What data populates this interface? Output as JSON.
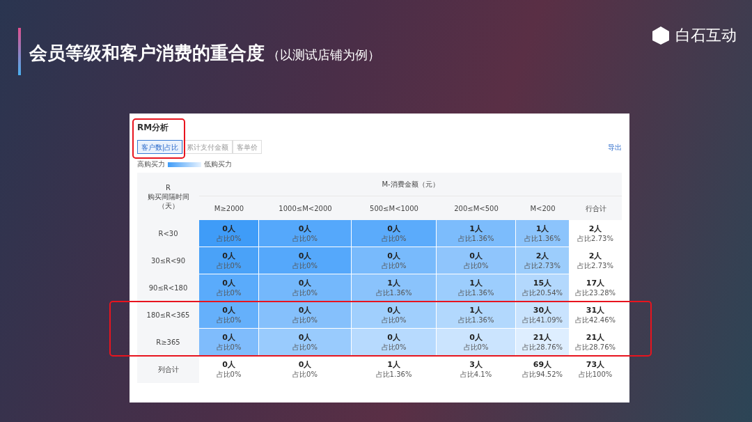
{
  "slide": {
    "title": "会员等级和客户消费的重合度",
    "subtitle": "（以测试店铺为例）",
    "logo_text": "白石互动"
  },
  "panel": {
    "title": "RM分析",
    "tabs": [
      {
        "label": "客户数|占比",
        "selected": true
      },
      {
        "label": "累计支付金额",
        "selected": false
      },
      {
        "label": "客单价",
        "selected": false
      }
    ],
    "export": "导出",
    "legend": {
      "high": "高购买力",
      "low": "低购买力"
    },
    "table": {
      "corner": [
        "R",
        "购买间隔时间",
        "（天）"
      ],
      "group_header": "M-消费金额（元）",
      "columns": [
        "M≥2000",
        "1000≤M<2000",
        "500≤M<1000",
        "200≤M<500",
        "M<200",
        "行合计"
      ],
      "rows": [
        {
          "label": "R<30",
          "cells": [
            {
              "count": "0人",
              "share": "占比0%",
              "color": "#3f9cf8"
            },
            {
              "count": "0人",
              "share": "占比0%",
              "color": "#55a8fb"
            },
            {
              "count": "0人",
              "share": "占比0%",
              "color": "#5babfb"
            },
            {
              "count": "1人",
              "share": "占比1.36%",
              "color": "#7cbcfc"
            },
            {
              "count": "1人",
              "share": "占比1.36%",
              "color": "#8cc4fc"
            }
          ],
          "total": {
            "count": "2人",
            "share": "占比2.73%"
          }
        },
        {
          "label": "30≤R<90",
          "cells": [
            {
              "count": "0人",
              "share": "占比0%",
              "color": "#4aa2f8"
            },
            {
              "count": "0人",
              "share": "占比0%",
              "color": "#55a8fb"
            },
            {
              "count": "0人",
              "share": "占比0%",
              "color": "#78bafc"
            },
            {
              "count": "0人",
              "share": "占比0%",
              "color": "#8fc5fc"
            },
            {
              "count": "2人",
              "share": "占比2.73%",
              "color": "#9ccdfc"
            }
          ],
          "total": {
            "count": "2人",
            "share": "占比2.73%"
          }
        },
        {
          "label": "90≤R<180",
          "cells": [
            {
              "count": "0人",
              "share": "占比0%",
              "color": "#5aabfb"
            },
            {
              "count": "0人",
              "share": "占比0%",
              "color": "#74b8fc"
            },
            {
              "count": "1人",
              "share": "占比1.36%",
              "color": "#8ac3fc"
            },
            {
              "count": "1人",
              "share": "占比1.36%",
              "color": "#9ccdfd"
            },
            {
              "count": "15人",
              "share": "占比20.54%",
              "color": "#b3d8fd"
            }
          ],
          "total": {
            "count": "17人",
            "share": "占比23.28%"
          }
        },
        {
          "label": "180≤R<365",
          "cells": [
            {
              "count": "0人",
              "share": "占比0%",
              "color": "#65b0fb"
            },
            {
              "count": "0人",
              "share": "占比0%",
              "color": "#85c0fc"
            },
            {
              "count": "0人",
              "share": "占比0%",
              "color": "#a0cffd"
            },
            {
              "count": "1人",
              "share": "占比1.36%",
              "color": "#b2d8fd"
            },
            {
              "count": "30人",
              "share": "占比41.09%",
              "color": "#c9e3fe"
            }
          ],
          "total": {
            "count": "31人",
            "share": "占比42.46%"
          }
        },
        {
          "label": "R≥365",
          "cells": [
            {
              "count": "0人",
              "share": "占比0%",
              "color": "#7fbcfc"
            },
            {
              "count": "0人",
              "share": "占比0%",
              "color": "#99cbfd"
            },
            {
              "count": "0人",
              "share": "占比0%",
              "color": "#b7dafe"
            },
            {
              "count": "0人",
              "share": "占比0%",
              "color": "#cbe4fe"
            },
            {
              "count": "21人",
              "share": "占比28.76%",
              "color": "#deeeff"
            }
          ],
          "total": {
            "count": "21人",
            "share": "占比28.76%"
          }
        }
      ],
      "footer": {
        "label": "列合计",
        "cells": [
          {
            "count": "0人",
            "share": "占比0%"
          },
          {
            "count": "0人",
            "share": "占比0%"
          },
          {
            "count": "1人",
            "share": "占比1.36%"
          },
          {
            "count": "3人",
            "share": "占比4.1%"
          },
          {
            "count": "69人",
            "share": "占比94.52%"
          }
        ],
        "total": {
          "count": "73人",
          "share": "占比100%"
        }
      }
    }
  }
}
